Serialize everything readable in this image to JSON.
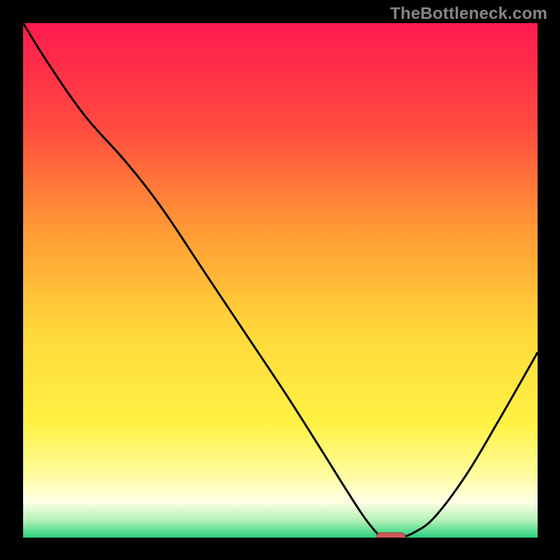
{
  "watermark": "TheBottleneck.com",
  "colors": {
    "frame": "#000000",
    "curve": "#000000",
    "marker_fill": "#d15a5a",
    "marker_stroke": "#a03e3e"
  },
  "chart_data": {
    "type": "line",
    "title": "",
    "xlabel": "",
    "ylabel": "",
    "xlim": [
      0,
      100
    ],
    "ylim": [
      0,
      100
    ],
    "grid": false,
    "legend": false,
    "background_gradient": {
      "stops": [
        {
          "pos": 0.0,
          "color": "#ff1a4f"
        },
        {
          "pos": 0.2,
          "color": "#ff4a3f"
        },
        {
          "pos": 0.4,
          "color": "#ff9a35"
        },
        {
          "pos": 0.6,
          "color": "#ffd83a"
        },
        {
          "pos": 0.78,
          "color": "#fff244"
        },
        {
          "pos": 0.88,
          "color": "#fffca0"
        },
        {
          "pos": 0.93,
          "color": "#ffffe6"
        },
        {
          "pos": 0.965,
          "color": "#b8f2b8"
        },
        {
          "pos": 1.0,
          "color": "#28d17c"
        }
      ]
    },
    "series": [
      {
        "name": "bottleneck-curve",
        "x": [
          0,
          5,
          12,
          20,
          27,
          35,
          43,
          51,
          58,
          63,
          67,
          70,
          73,
          76,
          80,
          86,
          92,
          100
        ],
        "y": [
          100,
          92,
          82,
          73,
          64,
          52,
          40,
          28,
          17,
          9,
          3,
          0,
          0,
          1,
          4,
          12,
          22,
          36
        ]
      }
    ],
    "marker": {
      "x_center": 71.5,
      "x_halfwidth": 2.8,
      "y": 0
    }
  }
}
